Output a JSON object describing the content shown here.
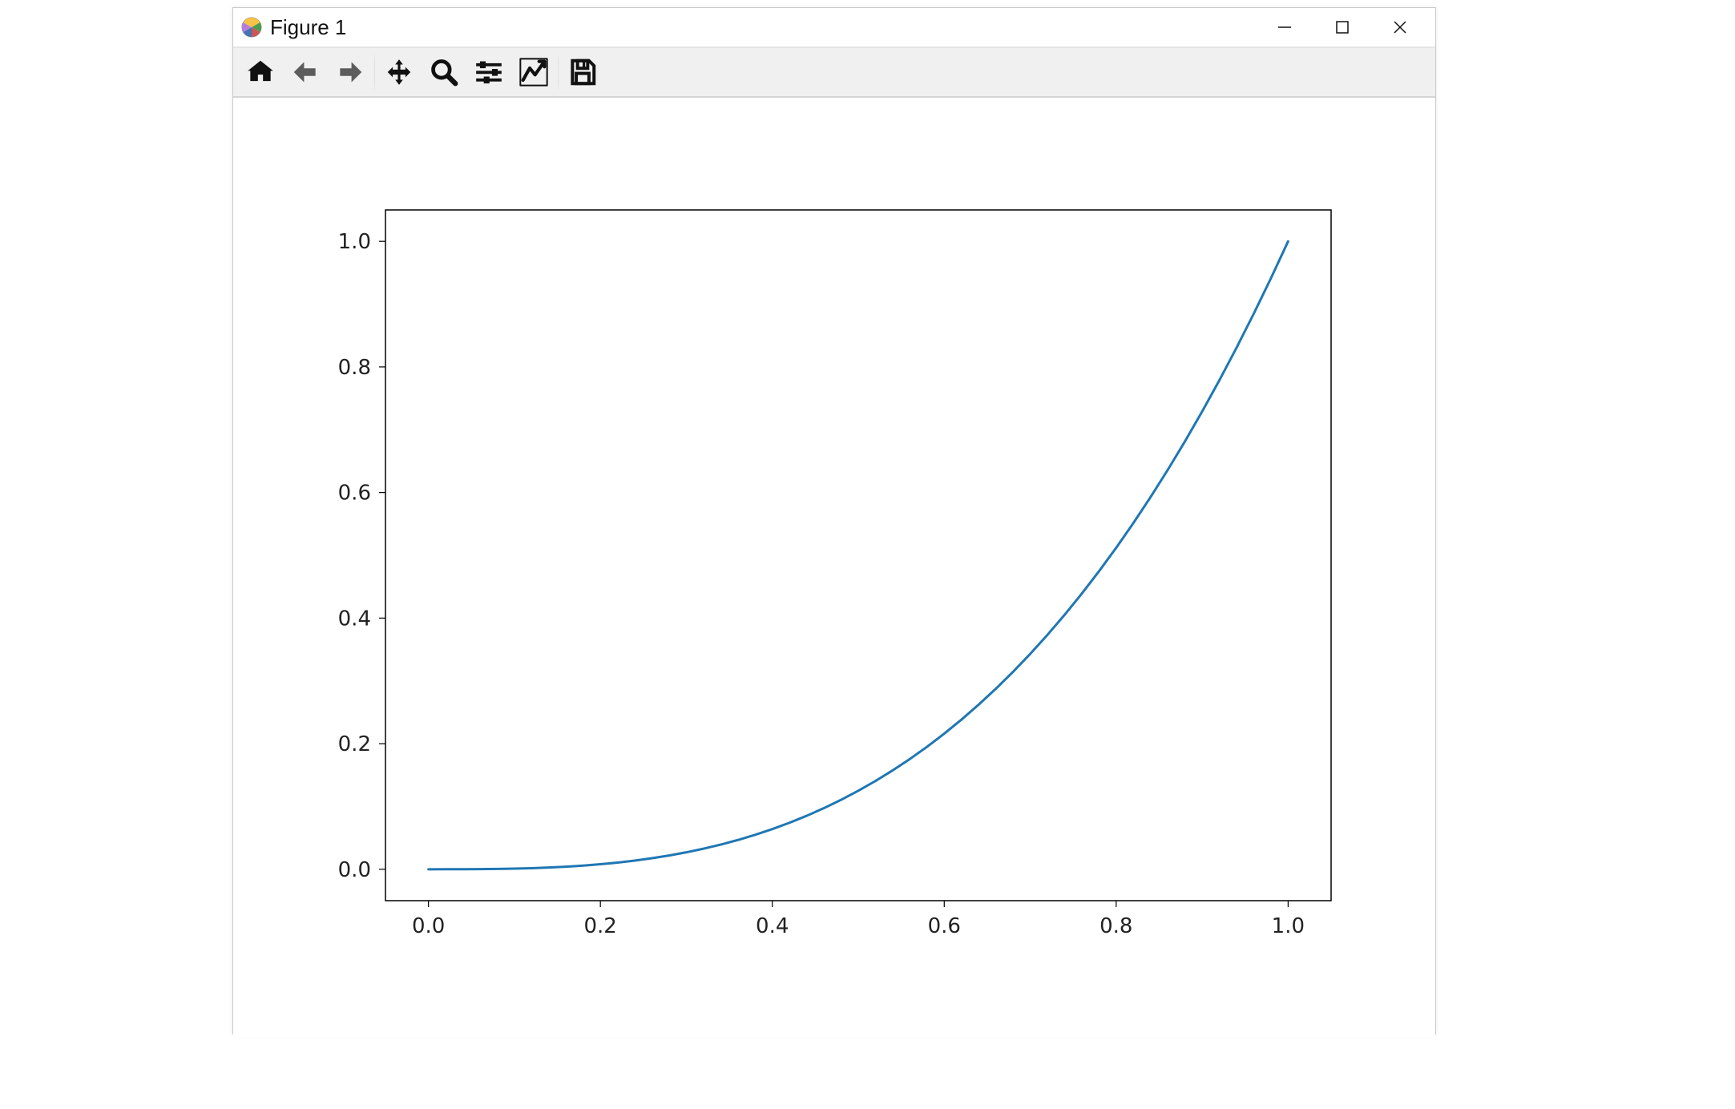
{
  "window": {
    "title": "Figure 1",
    "icons": {
      "app": "matplotlib-icon",
      "minimize": "minimize-icon",
      "maximize": "maximize-icon",
      "close": "close-icon"
    }
  },
  "toolbar": {
    "items": [
      {
        "name": "home-button",
        "icon": "home-icon"
      },
      {
        "name": "back-button",
        "icon": "arrow-left-icon"
      },
      {
        "name": "forward-button",
        "icon": "arrow-right-icon"
      },
      {
        "sep": true
      },
      {
        "name": "pan-button",
        "icon": "move-icon"
      },
      {
        "name": "zoom-button",
        "icon": "zoom-icon"
      },
      {
        "name": "configure-subplots-button",
        "icon": "sliders-icon"
      },
      {
        "name": "edit-axis-button",
        "icon": "chart-line-icon"
      },
      {
        "sep": true
      },
      {
        "name": "save-button",
        "icon": "save-icon"
      }
    ]
  },
  "chart_data": {
    "type": "line",
    "title": "",
    "xlabel": "",
    "ylabel": "",
    "xlim": [
      0.0,
      1.0
    ],
    "ylim": [
      0.0,
      1.0
    ],
    "x_ticks": [
      0.0,
      0.2,
      0.4,
      0.6,
      0.8,
      1.0
    ],
    "y_ticks": [
      0.0,
      0.2,
      0.4,
      0.6,
      0.8,
      1.0
    ],
    "x_tick_labels": [
      "0.0",
      "0.2",
      "0.4",
      "0.6",
      "0.8",
      "1.0"
    ],
    "y_tick_labels": [
      "0.0",
      "0.2",
      "0.4",
      "0.6",
      "0.8",
      "1.0"
    ],
    "grid": false,
    "series": [
      {
        "name": "series1",
        "color": "#1f77b4",
        "x": [
          0.0,
          0.02,
          0.04,
          0.06,
          0.08,
          0.1,
          0.12,
          0.14,
          0.16,
          0.18,
          0.2,
          0.22,
          0.24,
          0.26,
          0.28,
          0.3,
          0.32,
          0.34,
          0.36,
          0.38,
          0.4,
          0.42,
          0.44,
          0.46,
          0.48,
          0.5,
          0.52,
          0.54,
          0.56,
          0.58,
          0.6,
          0.62,
          0.64,
          0.66,
          0.68,
          0.7,
          0.72,
          0.74,
          0.76,
          0.78,
          0.8,
          0.82,
          0.84,
          0.86,
          0.88,
          0.9,
          0.92,
          0.94,
          0.96,
          0.98,
          1.0
        ],
        "y": [
          0.0,
          8e-06,
          6.4e-05,
          0.000216,
          0.000512,
          0.001,
          0.001728,
          0.002744,
          0.004096,
          0.005832,
          0.008,
          0.010648,
          0.013824,
          0.017576,
          0.021952,
          0.027,
          0.032768,
          0.039304,
          0.046656,
          0.054872,
          0.064,
          0.074088,
          0.085184,
          0.097336,
          0.110592,
          0.125,
          0.140608,
          0.157464,
          0.175616,
          0.195112,
          0.216,
          0.238328,
          0.262144,
          0.287496,
          0.314432,
          0.343,
          0.373248,
          0.405224,
          0.438976,
          0.474552,
          0.512,
          0.551368,
          0.592704,
          0.636056,
          0.681472,
          0.729,
          0.778688,
          0.830584,
          0.884736,
          0.941192,
          1.0
        ]
      }
    ]
  }
}
